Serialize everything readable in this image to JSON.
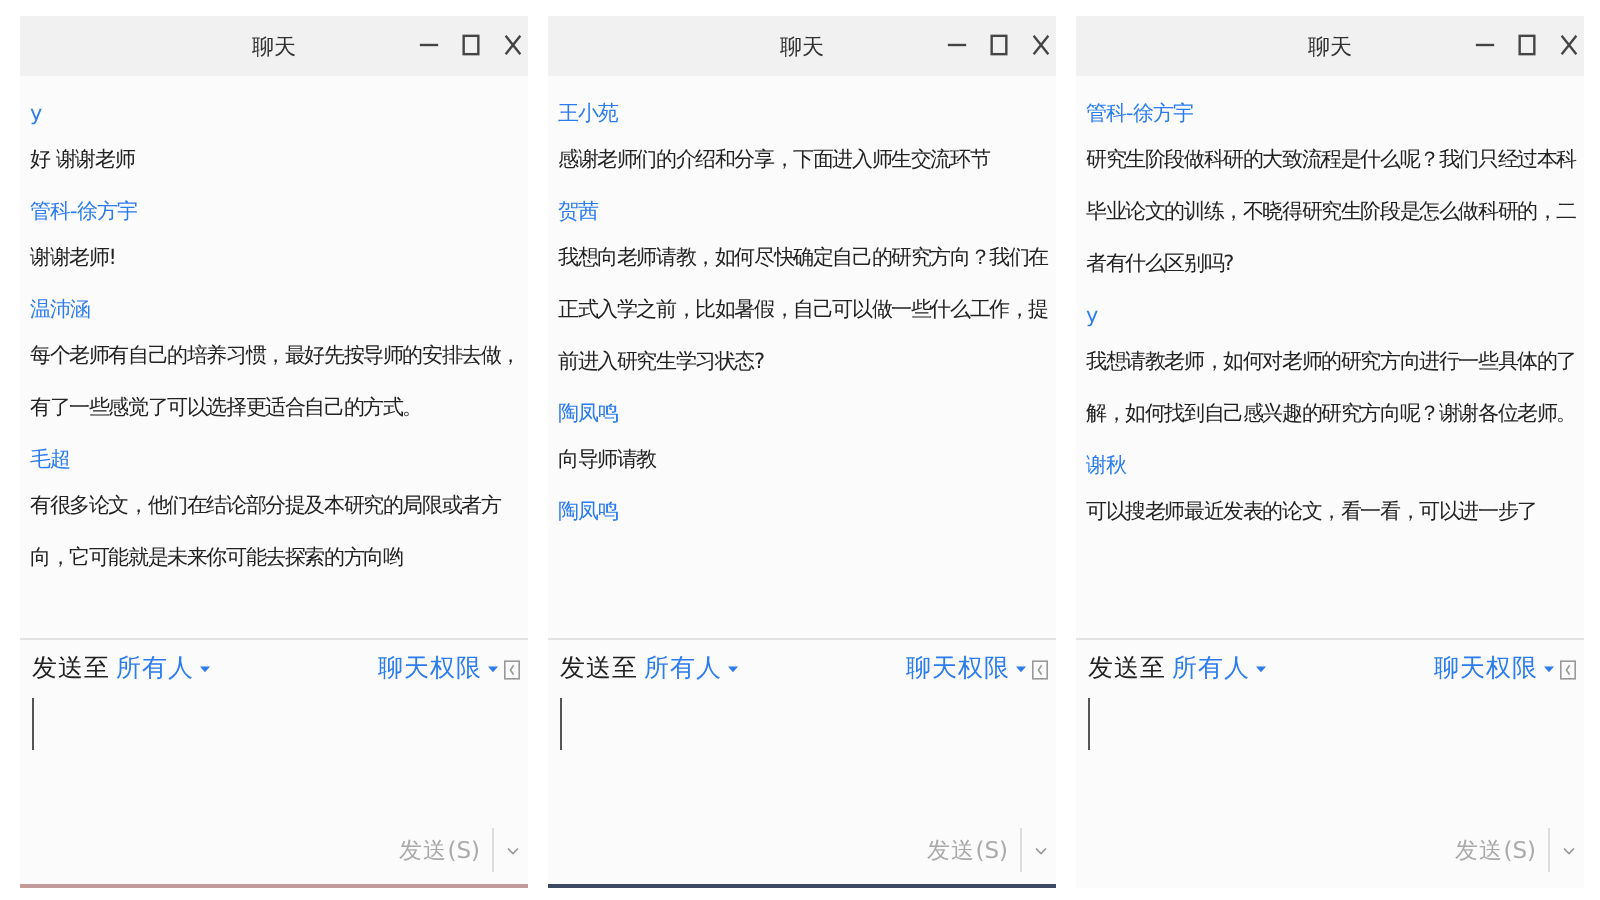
{
  "windows": [
    {
      "title": "聊天",
      "messages": [
        {
          "sender": "y",
          "text": "好 谢谢老师"
        },
        {
          "sender": "管科-徐方宇",
          "text": "谢谢老师!"
        },
        {
          "sender": "温沛涵",
          "text": "每个老师有自己的培养习惯，最好先按导师的安排去做，有了一些感觉了可以选择更适合自己的方式。"
        },
        {
          "sender": "毛超",
          "text": "有很多论文，他们在结论部分提及本研究的局限或者方向，它可能就是未来你可能去探索的方向哟"
        }
      ],
      "send_to_label": "发送至",
      "recipient": "所有人",
      "permissions": "聊天权限",
      "send_button": "发送(S)"
    },
    {
      "title": "聊天",
      "messages": [
        {
          "sender": "王小苑",
          "text": "感谢老师们的介绍和分享，下面进入师生交流环节"
        },
        {
          "sender": "贺茜",
          "text": "我想向老师请教，如何尽快确定自己的研究方向？我们在正式入学之前，比如暑假，自己可以做一些什么工作，提前进入研究生学习状态?"
        },
        {
          "sender": "陶凤鸣",
          "text": "向导师请教"
        },
        {
          "sender": "陶凤鸣"
        }
      ],
      "send_to_label": "发送至",
      "recipient": "所有人",
      "permissions": "聊天权限",
      "send_button": "发送(S)"
    },
    {
      "title": "聊天",
      "messages": [
        {
          "sender": "管科-徐方宇",
          "text": "研究生阶段做科研的大致流程是什么呢？我们只经过本科毕业论文的训练，不晓得研究生阶段是怎么做科研的，二者有什么区别吗?"
        },
        {
          "sender": "y",
          "text": "我想请教老师，如何对老师的研究方向进行一些具体的了解，如何找到自己感兴趣的研究方向呢？谢谢各位老师。"
        },
        {
          "sender": "谢秋",
          "text": "可以搜老师最近发表的论文，看一看，可以进一步了"
        }
      ],
      "send_to_label": "发送至",
      "recipient": "所有人",
      "permissions": "聊天权限",
      "send_button": "发送(S)"
    }
  ]
}
